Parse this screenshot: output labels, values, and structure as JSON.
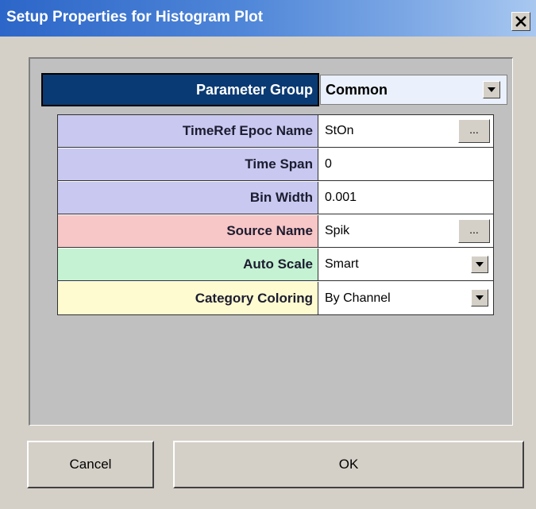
{
  "window": {
    "title": "Setup Properties for Histogram Plot",
    "close_glyph": "✕"
  },
  "parameter_group": {
    "label": "Parameter Group",
    "value": "Common"
  },
  "properties": [
    {
      "label": "TimeRef Epoc Name",
      "value": "StOn",
      "control": "ellipsis",
      "button_label": "..."
    },
    {
      "label": "Time Span",
      "value": "0",
      "control": "text"
    },
    {
      "label": "Bin Width",
      "value": "0.001",
      "control": "text"
    },
    {
      "label": "Source Name",
      "value": "Spik",
      "control": "ellipsis",
      "button_label": "..."
    },
    {
      "label": "Auto Scale",
      "value": "Smart",
      "control": "dropdown"
    },
    {
      "label": "Category Coloring",
      "value": "By Channel",
      "control": "dropdown"
    }
  ],
  "buttons": {
    "cancel": "Cancel",
    "ok": "OK"
  },
  "colors": {
    "titlebar_start": "#2c66c8",
    "group_header_bg": "#0a3a73",
    "lavender": "#c8c8f0",
    "pink": "#f7c6c6",
    "mint": "#c4f2d2",
    "cream": "#fffbd0"
  }
}
